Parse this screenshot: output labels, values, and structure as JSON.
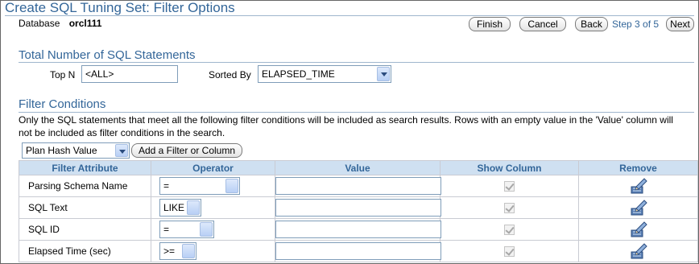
{
  "header": {
    "title": "Create SQL Tuning Set: Filter Options",
    "database_label": "Database",
    "database_value": "orcl111"
  },
  "nav": {
    "finish": "Finish",
    "cancel": "Cancel",
    "back": "Back",
    "step": "Step 3 of 5",
    "next": "Next"
  },
  "total_section": {
    "heading": "Total Number of SQL Statements",
    "top_n_label": "Top N",
    "top_n_value": "<ALL>",
    "sorted_by_label": "Sorted By",
    "sorted_by_value": "ELAPSED_TIME"
  },
  "filter_section": {
    "heading": "Filter Conditions",
    "description": "Only the SQL statements that meet all the following filter conditions will be included as search results. Rows with an empty value in the 'Value' column will not be included as filter conditions in the search.",
    "add_select_value": "Plan Hash Value",
    "add_button": "Add a Filter or Column"
  },
  "table": {
    "columns": [
      "Filter Attribute",
      "Operator",
      "Value",
      "Show Column",
      "Remove"
    ],
    "rows": [
      {
        "attribute": "Parsing Schema Name",
        "operator": "=",
        "value": ""
      },
      {
        "attribute": "SQL Text",
        "operator": "LIKE",
        "value": ""
      },
      {
        "attribute": "SQL ID",
        "operator": "=",
        "value": ""
      },
      {
        "attribute": "Elapsed Time (sec)",
        "operator": ">=",
        "value": ""
      }
    ]
  },
  "colors": {
    "heading": "#336699",
    "header_bg": "#cfe0f1",
    "border": "#c9cbd3"
  },
  "icons": {
    "remove": "pencil-trash-icon",
    "dropdown": "chevron-down-icon"
  }
}
